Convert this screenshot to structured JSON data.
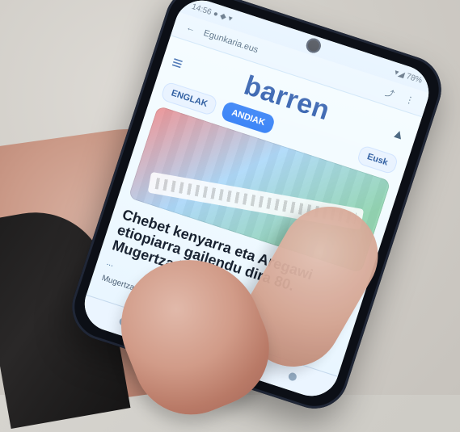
{
  "status_bar": {
    "left": "14:56 ●  ◆ ▾",
    "right": "▾◢ 78%"
  },
  "browser": {
    "url": "Egunkaria.eus",
    "share_icon": "share-icon",
    "menu_icon": "more-icon"
  },
  "app": {
    "logo": "barren",
    "menu_icon": "hamburger-icon"
  },
  "tabs": {
    "items": [
      "ENGLAK",
      "ANDIAK"
    ],
    "right": "Eusk"
  },
  "article": {
    "headline": "Chebet kenyarra eta Aregawi etiopiarra gailendu dira 80. Mugertza krosean",
    "subline": "...",
    "body": "Mugertza krosa ... (testua)"
  },
  "colors": {
    "accent": "#2e7cf6",
    "logo": "#1d4fa6"
  }
}
